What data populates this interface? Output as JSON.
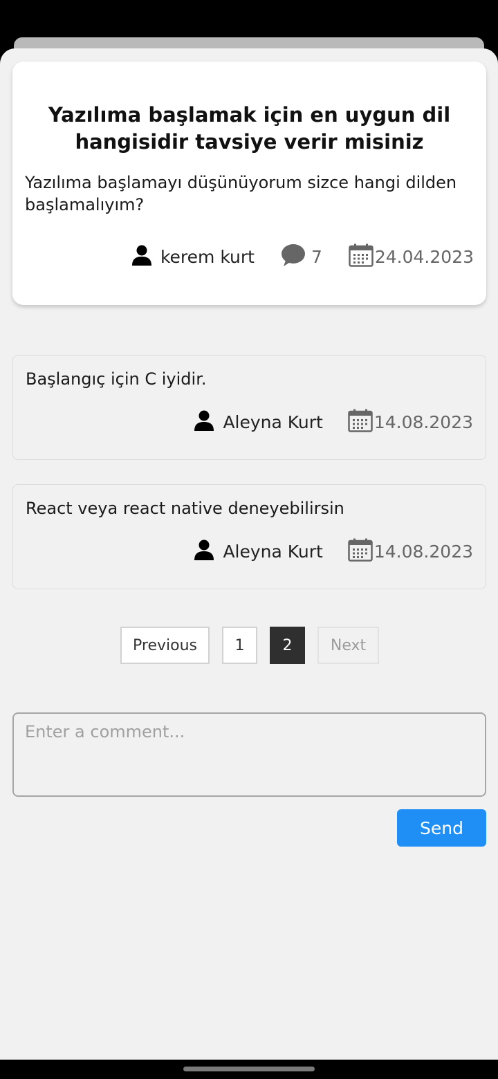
{
  "question": {
    "title": "Yazılıma başlamak için en uygun dil hangisidir tavsiye verir misiniz",
    "body": "Yazılıma başlamayı düşünüyorum sizce hangi dilden başlamalıyım?",
    "author": "kerem kurt",
    "comment_count": "7",
    "date": "24.04.2023"
  },
  "answers": [
    {
      "text": "Başlangıç için C iyidir.",
      "author": "Aleyna Kurt",
      "date": "14.08.2023"
    },
    {
      "text": "React veya react native deneyebilirsin",
      "author": "Aleyna Kurt",
      "date": "14.08.2023"
    }
  ],
  "pagination": {
    "previous_label": "Previous",
    "pages": [
      "1",
      "2"
    ],
    "active_page": "2",
    "next_label": "Next"
  },
  "comment_form": {
    "placeholder": "Enter a comment...",
    "value": "",
    "send_label": "Send"
  },
  "icons": {
    "author": "user-icon",
    "comments": "comment-bubble-icon",
    "date": "calendar-icon"
  },
  "colors": {
    "accent": "#1f8ff5",
    "active_page": "#2f2f2f",
    "background": "#f1f1f1"
  }
}
